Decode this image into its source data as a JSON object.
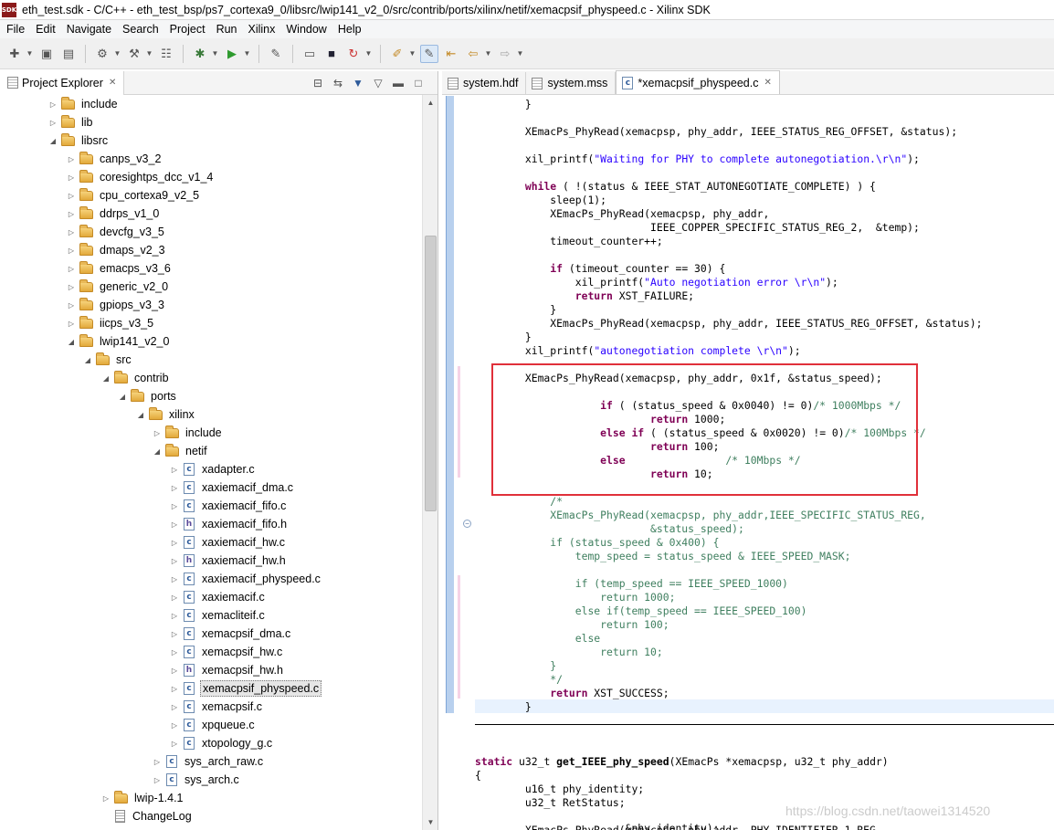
{
  "window": {
    "app_icon_text": "SDK",
    "title": "eth_test.sdk - C/C++ - eth_test_bsp/ps7_cortexa9_0/libsrc/lwip141_v2_0/src/contrib/ports/xilinx/netif/xemacpsif_physpeed.c - Xilinx SDK"
  },
  "menu": [
    "File",
    "Edit",
    "Navigate",
    "Search",
    "Project",
    "Run",
    "Xilinx",
    "Window",
    "Help"
  ],
  "toolbar": {
    "icons": [
      "new-icon",
      "save-icon",
      "save-all-icon",
      "settings-icon",
      "build-icon",
      "binary-icon",
      "debug-icon",
      "run-icon",
      "program-fpga-icon",
      "console-icon",
      "terminal-icon",
      "refresh-icon",
      "pin-icon",
      "highlight-icon",
      "back-nav-icon",
      "forward-nav-icon"
    ]
  },
  "explorer": {
    "title": "Project Explorer",
    "close": "✕",
    "tree": [
      {
        "label": "include",
        "type": "folder",
        "twisty": "▷"
      },
      {
        "label": "lib",
        "type": "folder",
        "twisty": "▷"
      },
      {
        "label": "libsrc",
        "type": "folder",
        "twisty": "◢"
      },
      {
        "label": "canps_v3_2",
        "type": "folder",
        "twisty": "▷"
      },
      {
        "label": "coresightps_dcc_v1_4",
        "type": "folder",
        "twisty": "▷"
      },
      {
        "label": "cpu_cortexa9_v2_5",
        "type": "folder",
        "twisty": "▷"
      },
      {
        "label": "ddrps_v1_0",
        "type": "folder",
        "twisty": "▷"
      },
      {
        "label": "devcfg_v3_5",
        "type": "folder",
        "twisty": "▷"
      },
      {
        "label": "dmaps_v2_3",
        "type": "folder",
        "twisty": "▷"
      },
      {
        "label": "emacps_v3_6",
        "type": "folder",
        "twisty": "▷"
      },
      {
        "label": "generic_v2_0",
        "type": "folder",
        "twisty": "▷"
      },
      {
        "label": "gpiops_v3_3",
        "type": "folder",
        "twisty": "▷"
      },
      {
        "label": "iicps_v3_5",
        "type": "folder",
        "twisty": "▷"
      },
      {
        "label": "lwip141_v2_0",
        "type": "folder",
        "twisty": "◢"
      },
      {
        "label": "src",
        "type": "folder",
        "twisty": "◢"
      },
      {
        "label": "contrib",
        "type": "folder",
        "twisty": "◢"
      },
      {
        "label": "ports",
        "type": "folder",
        "twisty": "◢"
      },
      {
        "label": "xilinx",
        "type": "folder",
        "twisty": "◢"
      },
      {
        "label": "include",
        "type": "folder",
        "twisty": "▷"
      },
      {
        "label": "netif",
        "type": "folder",
        "twisty": "◢"
      },
      {
        "label": "xadapter.c",
        "type": "c",
        "twisty": "▷"
      },
      {
        "label": "xaxiemacif_dma.c",
        "type": "c",
        "twisty": "▷"
      },
      {
        "label": "xaxiemacif_fifo.c",
        "type": "c",
        "twisty": "▷"
      },
      {
        "label": "xaxiemacif_fifo.h",
        "type": "h",
        "twisty": "▷"
      },
      {
        "label": "xaxiemacif_hw.c",
        "type": "c",
        "twisty": "▷"
      },
      {
        "label": "xaxiemacif_hw.h",
        "type": "h",
        "twisty": "▷"
      },
      {
        "label": "xaxiemacif_physpeed.c",
        "type": "c",
        "twisty": "▷"
      },
      {
        "label": "xaxiemacif.c",
        "type": "c",
        "twisty": "▷"
      },
      {
        "label": "xemacliteif.c",
        "type": "c",
        "twisty": "▷"
      },
      {
        "label": "xemacpsif_dma.c",
        "type": "c",
        "twisty": "▷"
      },
      {
        "label": "xemacpsif_hw.c",
        "type": "c",
        "twisty": "▷"
      },
      {
        "label": "xemacpsif_hw.h",
        "type": "h",
        "twisty": "▷"
      },
      {
        "label": "xemacpsif_physpeed.c",
        "type": "c",
        "twisty": "▷",
        "selected": true
      },
      {
        "label": "xemacpsif.c",
        "type": "c",
        "twisty": "▷"
      },
      {
        "label": "xpqueue.c",
        "type": "c",
        "twisty": "▷"
      },
      {
        "label": "xtopology_g.c",
        "type": "c",
        "twisty": "▷"
      },
      {
        "label": "sys_arch_raw.c",
        "type": "c",
        "twisty": "▷"
      },
      {
        "label": "sys_arch.c",
        "type": "c",
        "twisty": "▷"
      },
      {
        "label": "lwip-1.4.1",
        "type": "folder",
        "twisty": "▷"
      },
      {
        "label": "ChangeLog",
        "type": "text",
        "twisty": ""
      }
    ]
  },
  "editor": {
    "tabs": [
      {
        "label": "system.hdf",
        "icon": "file-icon"
      },
      {
        "label": "system.mss",
        "icon": "file-icon"
      },
      {
        "label": "*xemacpsif_physpeed.c",
        "icon": "c-file-icon",
        "close": "✕",
        "active": true
      }
    ],
    "code": [
      [
        [
          "t",
          "        }"
        ]
      ],
      [
        [
          "t",
          ""
        ]
      ],
      [
        [
          "t",
          "        XEmacPs_PhyRead(xemacpsp, phy_addr, IEEE_STATUS_REG_OFFSET, &status);"
        ]
      ],
      [
        [
          "t",
          ""
        ]
      ],
      [
        [
          "t",
          "        xil_printf("
        ],
        [
          "s",
          "\"Waiting for PHY to complete autonegotiation.\\r\\n\""
        ],
        [
          "t",
          ");"
        ]
      ],
      [
        [
          "t",
          ""
        ]
      ],
      [
        [
          "t",
          "        "
        ],
        [
          "k",
          "while"
        ],
        [
          "t",
          " ( !(status & IEEE_STAT_AUTONEGOTIATE_COMPLETE) ) {"
        ]
      ],
      [
        [
          "t",
          "            sleep(1);"
        ]
      ],
      [
        [
          "t",
          "            XEmacPs_PhyRead(xemacpsp, phy_addr,"
        ]
      ],
      [
        [
          "t",
          "                            IEEE_COPPER_SPECIFIC_STATUS_REG_2,  &temp);"
        ]
      ],
      [
        [
          "t",
          "            timeout_counter++;"
        ]
      ],
      [
        [
          "t",
          ""
        ]
      ],
      [
        [
          "t",
          "            "
        ],
        [
          "k",
          "if"
        ],
        [
          "t",
          " (timeout_counter == 30) {"
        ]
      ],
      [
        [
          "t",
          "                xil_printf("
        ],
        [
          "s",
          "\"Auto negotiation error \\r\\n\""
        ],
        [
          "t",
          ");"
        ]
      ],
      [
        [
          "t",
          "                "
        ],
        [
          "k",
          "return"
        ],
        [
          "t",
          " XST_FAILURE;"
        ]
      ],
      [
        [
          "t",
          "            }"
        ]
      ],
      [
        [
          "t",
          "            XEmacPs_PhyRead(xemacpsp, phy_addr, IEEE_STATUS_REG_OFFSET, &status);"
        ]
      ],
      [
        [
          "t",
          "        }"
        ]
      ],
      [
        [
          "t",
          "        xil_printf("
        ],
        [
          "s",
          "\"autonegotiation complete \\r\\n\""
        ],
        [
          "t",
          ");"
        ]
      ],
      [
        [
          "t",
          ""
        ]
      ],
      [
        [
          "t",
          "        XEmacPs_PhyRead(xemacpsp, phy_addr, 0x1f, &status_speed);"
        ]
      ],
      [
        [
          "t",
          ""
        ]
      ],
      [
        [
          "t",
          "                    "
        ],
        [
          "k",
          "if"
        ],
        [
          "t",
          " ( (status_speed & 0x0040) != 0)"
        ],
        [
          "c",
          "/* 1000Mbps */"
        ]
      ],
      [
        [
          "t",
          "                            "
        ],
        [
          "k",
          "return"
        ],
        [
          "t",
          " 1000;"
        ]
      ],
      [
        [
          "t",
          "                    "
        ],
        [
          "k",
          "else if"
        ],
        [
          "t",
          " ( (status_speed & 0x0020) != 0)"
        ],
        [
          "c",
          "/* 100Mbps */"
        ]
      ],
      [
        [
          "t",
          "                            "
        ],
        [
          "k",
          "return"
        ],
        [
          "t",
          " 100;"
        ]
      ],
      [
        [
          "t",
          "                    "
        ],
        [
          "k",
          "else"
        ],
        [
          "t",
          "                "
        ],
        [
          "c",
          "/* 10Mbps */"
        ]
      ],
      [
        [
          "t",
          "                            "
        ],
        [
          "k",
          "return"
        ],
        [
          "t",
          " 10;"
        ]
      ],
      [
        [
          "t",
          ""
        ]
      ],
      [
        [
          "c",
          "            /*"
        ]
      ],
      [
        [
          "c",
          "            XEmacPs_PhyRead(xemacpsp, phy_addr,IEEE_SPECIFIC_STATUS_REG,"
        ]
      ],
      [
        [
          "c",
          "                            &status_speed);"
        ]
      ],
      [
        [
          "c",
          "            if (status_speed & 0x400) {"
        ]
      ],
      [
        [
          "c",
          "                temp_speed = status_speed & IEEE_SPEED_MASK;"
        ]
      ],
      [
        [
          "c",
          ""
        ]
      ],
      [
        [
          "c",
          "                if (temp_speed == IEEE_SPEED_1000)"
        ]
      ],
      [
        [
          "c",
          "                    return 1000;"
        ]
      ],
      [
        [
          "c",
          "                else if(temp_speed == IEEE_SPEED_100)"
        ]
      ],
      [
        [
          "c",
          "                    return 100;"
        ]
      ],
      [
        [
          "c",
          "                else"
        ]
      ],
      [
        [
          "c",
          "                    return 10;"
        ]
      ],
      [
        [
          "c",
          "            }"
        ]
      ],
      [
        [
          "c",
          "            */"
        ]
      ],
      [
        [
          "t",
          "            "
        ],
        [
          "k",
          "return"
        ],
        [
          "t",
          " XST_SUCCESS;"
        ]
      ],
      [
        [
          "t",
          "        }"
        ]
      ],
      [
        [
          "t",
          ""
        ]
      ],
      [
        [
          "t",
          ""
        ]
      ],
      [
        [
          "k",
          "static"
        ],
        [
          "t",
          " u32_t "
        ],
        [
          "b",
          "get_IEEE_phy_speed"
        ],
        [
          "t",
          "(XEmacPs *xemacpsp, u32_t phy_addr)"
        ]
      ],
      [
        [
          "t",
          "{"
        ]
      ],
      [
        [
          "t",
          "        u16_t phy_identity;"
        ]
      ],
      [
        [
          "t",
          "        u32_t RetStatus;"
        ]
      ],
      [
        [
          "t",
          ""
        ]
      ],
      [
        [
          "t",
          "        XEmacPs_PhyRead(xemacpsp, phy_addr, PHY_IDENTIFIER_1_REG,"
        ]
      ],
      [
        [
          "t",
          "                        &phy_identity);"
        ]
      ]
    ]
  },
  "watermark": "https://blog.csdn.net/taowei1314520",
  "colors": {
    "highlight_box": "#e0303a",
    "keyword": "#7f0055",
    "string": "#2a00ff",
    "comment": "#3f7f5f"
  }
}
